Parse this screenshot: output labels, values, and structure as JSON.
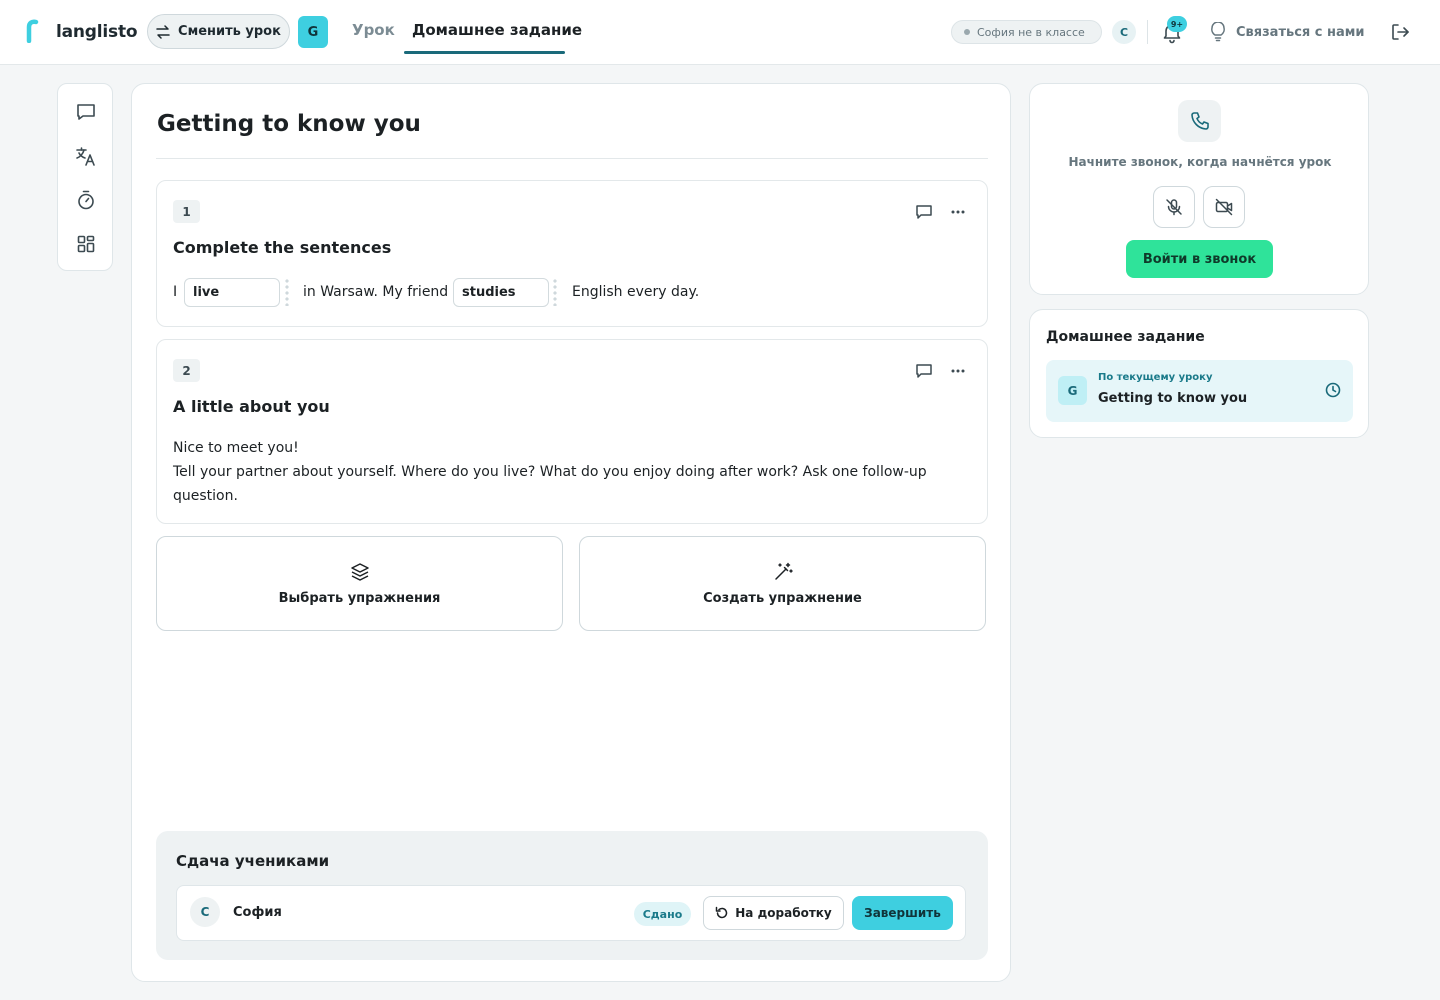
{
  "app": {
    "name": "langlisto"
  },
  "header": {
    "switch_label": "Сменить урок",
    "lesson_badge": "G",
    "tabs": [
      {
        "label": "Урок",
        "active": false
      },
      {
        "label": "Домашнее задание",
        "active": true
      }
    ],
    "student_status": "София не в классе",
    "user_initial": "С",
    "notifications_badge": "9+",
    "contact_label": "Связаться с нами"
  },
  "main": {
    "title": "Getting to know you",
    "exercises": [
      {
        "number": "1",
        "title": "Complete the sentences",
        "parts": {
          "t1": "I",
          "blank1": "live",
          "t2": "in Warsaw. My friend",
          "blank2": "studies",
          "t3": "English every day."
        }
      },
      {
        "number": "2",
        "title": "A little about you",
        "line1": "Nice to meet you!",
        "line2": "Tell your partner about yourself. Where do you live? What do you enjoy doing after work? Ask one follow-up question."
      }
    ],
    "tiles": {
      "choose": "Выбрать упражнения",
      "create": "Создать упражнение"
    },
    "submissions": {
      "title": "Сдача учениками",
      "rows": [
        {
          "initial": "С",
          "name": "София",
          "status": "Сдано",
          "rework_label": "На доработку",
          "finish_label": "Завершить"
        }
      ]
    }
  },
  "call": {
    "hint": "Начните звонок, когда начнётся урок",
    "join_label": "Войти в звонок"
  },
  "homework_panel": {
    "title": "Домашнее задание",
    "item": {
      "badge": "G",
      "kicker": "По текущему уроку",
      "name": "Getting to know you"
    }
  },
  "colors": {
    "accent": "#3ecfe0",
    "primary_dark": "#1a6a7a",
    "join_green": "#2fe39a"
  }
}
